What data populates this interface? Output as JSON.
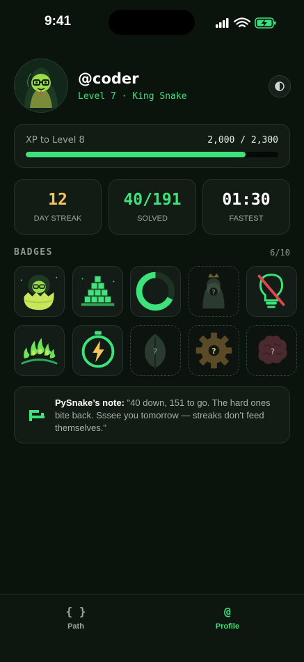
{
  "status_bar": {
    "time": "9:41"
  },
  "profile": {
    "username": "@coder",
    "level_text": "Level 7 · King Snake"
  },
  "xp": {
    "label": "XP to Level 8",
    "value_text": "2,000 / 2,300",
    "progress": 0.87
  },
  "stats": [
    {
      "value": "12",
      "label": "DAY STREAK",
      "color": "#f2c55c"
    },
    {
      "value": "40/191",
      "label": "SOLVED",
      "color": "#3ee27a"
    },
    {
      "value": "01:30",
      "label": "FASTEST",
      "color": "#ffffff"
    }
  ],
  "badges": {
    "title": "BADGES",
    "count": "6/10",
    "items": [
      {
        "icon": "hatching-snake-egg-icon",
        "unlocked": true
      },
      {
        "icon": "code-blocks-pyramid-icon",
        "unlocked": true
      },
      {
        "icon": "progress-ring-icon",
        "unlocked": true
      },
      {
        "icon": "crowned-snake-icon",
        "unlocked": false
      },
      {
        "icon": "no-hints-lightbulb-icon",
        "unlocked": true
      },
      {
        "icon": "flame-crown-icon",
        "unlocked": true
      },
      {
        "icon": "lightning-stopwatch-icon",
        "unlocked": true
      },
      {
        "icon": "leaf-icon",
        "unlocked": false
      },
      {
        "icon": "gear-icon",
        "unlocked": false
      },
      {
        "icon": "brain-icon",
        "unlocked": false
      }
    ]
  },
  "note": {
    "author": "PySnake’s note:",
    "text": "\"40 down, 151 to go. The hard ones bite back. Sssee you tomorrow — streaks don’t feed themselves.\""
  },
  "tabs": [
    {
      "icon": "{ }",
      "label": "Path",
      "active": false
    },
    {
      "icon": "@",
      "label": "Profile",
      "active": true
    }
  ],
  "colors": {
    "accent": "#3ee27a",
    "background": "#0b130d",
    "card": "#121c15",
    "streak": "#f2c55c"
  }
}
